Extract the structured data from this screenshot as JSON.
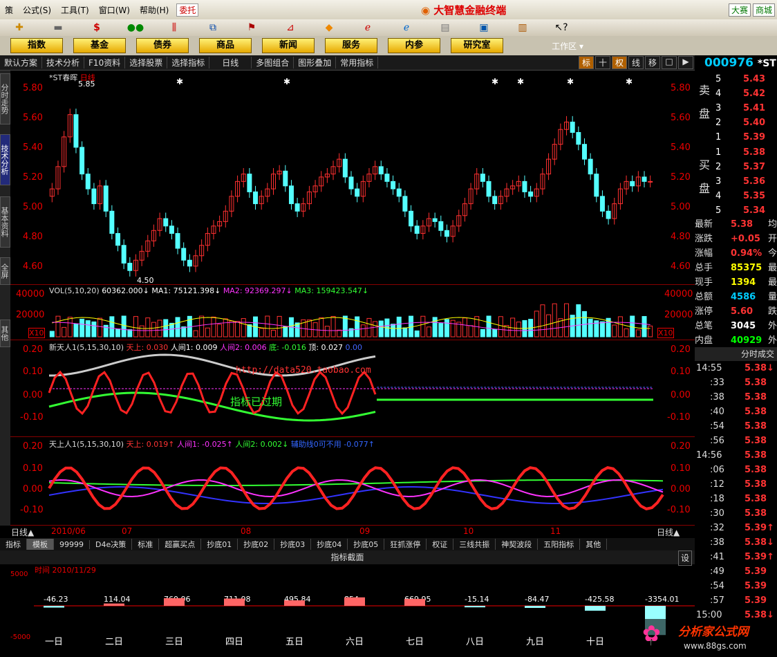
{
  "menubar": {
    "menus": [
      "策",
      "公式(S)",
      "工具(T)",
      "窗口(W)",
      "帮助(H)"
    ],
    "weituo": "委托",
    "title": "大智慧金融终端",
    "right_buttons": [
      "大赛",
      "商城"
    ]
  },
  "nav": {
    "buttons": [
      "指数",
      "基金",
      "债券",
      "商品",
      "新闻",
      "服务",
      "内参",
      "研究室"
    ],
    "workspace": "工作区"
  },
  "subbar": {
    "items": [
      "默认方案",
      "技术分析",
      "F10资料",
      "选择股票",
      "选择指标",
      "日线",
      "多图组合",
      "图形叠加",
      "常用指标"
    ],
    "right": [
      "标",
      "十",
      "权",
      "线",
      "移",
      "□",
      "▶"
    ]
  },
  "stock": {
    "code": "000976",
    "name": "*ST"
  },
  "sidetabs": [
    "分时走势",
    "技术分析",
    "基本资料",
    "全屏",
    "其他"
  ],
  "pane1": {
    "title": "*ST春晖",
    "period": "日线",
    "high_label": "5.85",
    "low_label": "4.50",
    "yticks": [
      "5.80",
      "5.60",
      "5.40",
      "5.20",
      "5.00",
      "4.80",
      "4.60"
    ]
  },
  "pane2": {
    "title": "VOL(5,10,20)",
    "val": "60362.000↓",
    "ma1": "MA1: 75121.398↓",
    "ma2": "MA2: 92369.297↓",
    "ma3": "MA3: 159423.547↓",
    "yticks": [
      "40000",
      "20000",
      "X10"
    ]
  },
  "pane3": {
    "title": "新天人1(5,15,30,10)",
    "tian": "天上: 0.030",
    "ren1": "人间1: 0.009",
    "ren2": "人间2: 0.006",
    "di": "底: -0.016",
    "ding": "顶: 0.027",
    "zero": "0.00",
    "url": "http://data520.taobao.com",
    "expired": "指标已过期",
    "yticks": [
      "0.20",
      "0.10",
      "0.00",
      "-0.10"
    ]
  },
  "pane4": {
    "title": "天上人1(5,15,30,10)",
    "tian": "天上: 0.019↑",
    "ren1": "人间1: -0.025↑",
    "ren2": "人间2: 0.002↓",
    "aux": "辅助线0可不用",
    "auxv": "-0.077↑",
    "yticks": [
      "0.20",
      "0.10",
      "0.00",
      "-0.10"
    ]
  },
  "xaxis": {
    "left": "日线▲",
    "labels": [
      "2010/06",
      "07",
      "08",
      "09",
      "10",
      "11"
    ],
    "right": "日线▲"
  },
  "bottomtabs": [
    "指标",
    "模板",
    "99999",
    "D4e决策",
    "标准",
    "超赢买点",
    "抄底01",
    "抄底02",
    "抄底03",
    "抄底04",
    "抄底05",
    "狂抓涨停",
    "权证",
    "三线共振",
    "神契波段",
    "五阳指标",
    "其他"
  ],
  "section": {
    "title": "指标截面",
    "set": "设"
  },
  "lower": {
    "time": "时间 2010/11/29",
    "ymax": "5000",
    "ymin": "-5000",
    "values": [
      "-46.23",
      "114.04",
      "760.06",
      "711.08",
      "495.84",
      "854",
      "669.95",
      "-15.14",
      "-84.47",
      "-425.58",
      "-3354.01"
    ],
    "days": [
      "一日",
      "二日",
      "三日",
      "四日",
      "五日",
      "六日",
      "七日",
      "八日",
      "九日",
      "十日",
      "十"
    ]
  },
  "orderbook": {
    "sell_label": "卖盘",
    "buy_label": "买盘",
    "sells": [
      [
        "5",
        "5.43"
      ],
      [
        "4",
        "5.42"
      ],
      [
        "3",
        "5.41"
      ],
      [
        "2",
        "5.40"
      ],
      [
        "1",
        "5.39"
      ]
    ],
    "buys": [
      [
        "1",
        "5.38"
      ],
      [
        "2",
        "5.37"
      ],
      [
        "3",
        "5.36"
      ],
      [
        "4",
        "5.35"
      ],
      [
        "5",
        "5.34"
      ]
    ]
  },
  "quote": [
    [
      "最新",
      "5.38",
      "均"
    ],
    [
      "涨跌",
      "+0.05",
      "开"
    ],
    [
      "涨幅",
      "0.94%",
      "今"
    ],
    [
      "总手",
      "85375",
      "最"
    ],
    [
      "现手",
      "1394",
      "最"
    ],
    [
      "总额",
      "4586",
      "量"
    ],
    [
      "涨停",
      "5.60",
      "跌"
    ],
    [
      "总笔",
      "3045",
      "外"
    ],
    [
      "内盘",
      "40929",
      "外"
    ]
  ],
  "ticks_header": "分时成交",
  "ticks": [
    [
      "14:55",
      "5.38↓"
    ],
    [
      ":33",
      "5.38"
    ],
    [
      ":38",
      "5.38"
    ],
    [
      ":40",
      "5.38"
    ],
    [
      ":54",
      "5.38"
    ],
    [
      ":56",
      "5.38"
    ],
    [
      "14:56",
      "5.38"
    ],
    [
      ":06",
      "5.38"
    ],
    [
      ":12",
      "5.38"
    ],
    [
      ":18",
      "5.38"
    ],
    [
      ":30",
      "5.38"
    ],
    [
      ":32",
      "5.39↑"
    ],
    [
      ":38",
      "5.38↓"
    ],
    [
      ":41",
      "5.39↑"
    ],
    [
      ":49",
      "5.39"
    ],
    [
      ":54",
      "5.39"
    ],
    [
      ":57",
      "5.39"
    ],
    [
      "15:00",
      "5.38↓"
    ]
  ],
  "watermark": "分析家公式网",
  "watermark_url": "www.88gs.com",
  "colors": {
    "up": "#ff3030",
    "down": "#54ffff",
    "accent": "#e6a800"
  },
  "chart_data": {
    "type": "candlestick",
    "title": "*ST春晖 日线",
    "x": [
      "2010/06",
      "07",
      "08",
      "09",
      "10",
      "11"
    ],
    "yrange": [
      4.5,
      5.85
    ],
    "closes": [
      5.1,
      5.25,
      5.45,
      5.6,
      5.38,
      5.2,
      5.1,
      5.0,
      5.12,
      4.95,
      4.8,
      4.72,
      4.6,
      4.55,
      4.62,
      4.68,
      4.75,
      4.82,
      4.9,
      4.85,
      4.8,
      4.7,
      4.62,
      4.58,
      4.65,
      4.72,
      4.8,
      4.85,
      4.88,
      4.95,
      5.05,
      5.15,
      5.2,
      5.08,
      5.0,
      5.05,
      5.1,
      5.2,
      5.22,
      5.12,
      5.0,
      4.95,
      5.0,
      5.08,
      5.12,
      5.18,
      5.2,
      5.25,
      5.3,
      5.18,
      5.1,
      5.05,
      5.15,
      5.2,
      5.25,
      5.2,
      5.15,
      5.1,
      5.05,
      4.95,
      4.85,
      4.8,
      4.85,
      4.9,
      4.88,
      4.82,
      4.78,
      4.85,
      4.92,
      5.0,
      5.1,
      5.2,
      5.15,
      5.05,
      5.0,
      5.05,
      5.1,
      5.12,
      5.15,
      5.08,
      5.05,
      5.1,
      5.2,
      5.3,
      5.4,
      5.5,
      5.55,
      5.48,
      5.4,
      5.3,
      5.2,
      5.05,
      4.95,
      4.9,
      5.0,
      5.1,
      5.15,
      5.12,
      5.18,
      5.15,
      5.15
    ]
  }
}
